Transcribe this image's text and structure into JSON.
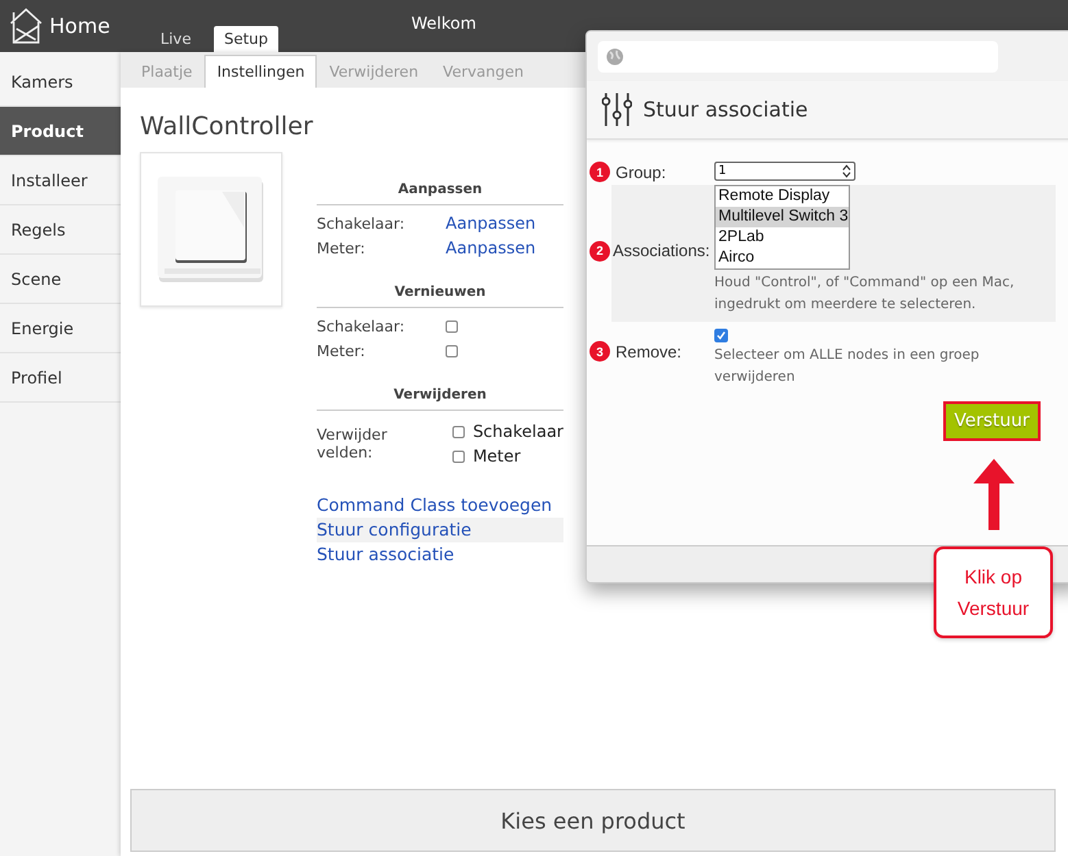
{
  "header": {
    "home": "Home",
    "welcome": "Welkom"
  },
  "top_tabs": [
    {
      "label": "Live",
      "selected": false
    },
    {
      "label": "Setup",
      "selected": true
    }
  ],
  "sidebar": {
    "items": [
      {
        "label": "Kamers",
        "selected": false
      },
      {
        "label": "Product",
        "selected": true
      },
      {
        "label": "Installeer",
        "selected": false
      },
      {
        "label": "Regels",
        "selected": false
      },
      {
        "label": "Scene",
        "selected": false
      },
      {
        "label": "Energie",
        "selected": false
      },
      {
        "label": "Profiel",
        "selected": false
      }
    ]
  },
  "sub_tabs": [
    {
      "label": "Plaatje",
      "selected": false
    },
    {
      "label": "Instellingen",
      "selected": true
    },
    {
      "label": "Verwijderen",
      "selected": false
    },
    {
      "label": "Vervangen",
      "selected": false
    }
  ],
  "product": {
    "title": "WallController",
    "sections": [
      {
        "heading": "Aanpassen",
        "rows": [
          {
            "kind": "link",
            "label": "Schakelaar:",
            "value": "Aanpassen"
          },
          {
            "kind": "link",
            "label": "Meter:",
            "value": "Aanpassen"
          }
        ]
      },
      {
        "heading": "Vernieuwen",
        "rows": [
          {
            "kind": "checkbox",
            "label": "Schakelaar:",
            "checked": false
          },
          {
            "kind": "checkbox",
            "label": "Meter:",
            "checked": false
          }
        ]
      },
      {
        "heading": "Verwijderen",
        "rows": [
          {
            "kind": "checklist",
            "label": "Verwijder velden:",
            "options": [
              {
                "label": "Schakelaar",
                "checked": false
              },
              {
                "label": "Meter",
                "checked": false
              }
            ]
          }
        ]
      }
    ],
    "links": [
      {
        "label": "Command Class toevoegen",
        "selected": false
      },
      {
        "label": "Stuur configuratie",
        "selected": true
      },
      {
        "label": "Stuur associatie",
        "selected": false
      }
    ]
  },
  "bottom_bar": {
    "label": "Kies een product"
  },
  "dialog": {
    "title": "Stuur associatie",
    "fields": [
      {
        "kind": "number",
        "badge": "1",
        "label": "Group:",
        "value": "1"
      },
      {
        "kind": "listbox",
        "badge": "2",
        "label": "Associations:",
        "options": [
          {
            "label": "Remote Display",
            "selected": false
          },
          {
            "label": "Multilevel Switch 3",
            "selected": true
          },
          {
            "label": "2PLab",
            "selected": false
          },
          {
            "label": "Airco",
            "selected": false
          }
        ],
        "hint": "Houd \"Control\", of \"Command\" op een Mac, ingedrukt om meerdere te selecteren."
      },
      {
        "kind": "checkbox",
        "badge": "3",
        "label": "Remove:",
        "checked": true,
        "hint": "Selecteer om ALLE nodes in een groep verwijderen"
      }
    ],
    "submit": "Verstuur"
  },
  "callout": {
    "text": "Klik op Verstuur"
  }
}
